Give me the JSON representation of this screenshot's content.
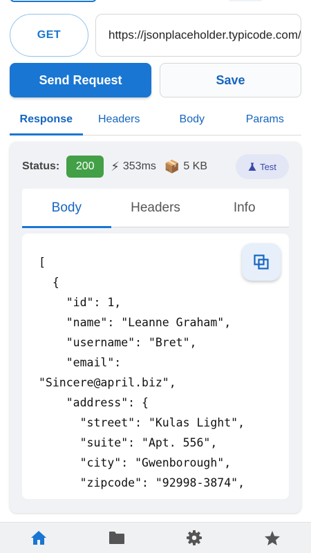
{
  "request": {
    "method": "GET",
    "url": "https://jsonplaceholder.typicode.com/users",
    "send_label": "Send Request",
    "save_label": "Save"
  },
  "main_tabs": [
    {
      "label": "Response",
      "active": true
    },
    {
      "label": "Headers",
      "active": false
    },
    {
      "label": "Body",
      "active": false
    },
    {
      "label": "Params",
      "active": false
    }
  ],
  "response": {
    "status_label": "Status:",
    "status_code": "200",
    "time_icon": "lightning-icon",
    "time": "353ms",
    "size_icon": "package-icon",
    "size": "5 KB",
    "test_icon": "flask-icon",
    "test_label": "Test",
    "sub_tabs": [
      {
        "label": "Body",
        "active": true
      },
      {
        "label": "Headers",
        "active": false
      },
      {
        "label": "Info",
        "active": false
      }
    ],
    "body_text": "[\n  {\n    \"id\": 1,\n    \"name\": \"Leanne Graham\",\n    \"username\": \"Bret\",\n    \"email\":\n\"Sincere@april.biz\",\n    \"address\": {\n      \"street\": \"Kulas Light\",\n      \"suite\": \"Apt. 556\",\n      \"city\": \"Gwenborough\",\n      \"zipcode\": \"92998-3874\",",
    "copy_icon": "copy-icon"
  },
  "bottom_nav": [
    {
      "icon": "home-icon",
      "active": true
    },
    {
      "icon": "folder-icon",
      "active": false
    },
    {
      "icon": "gear-icon",
      "active": false
    },
    {
      "icon": "star-icon",
      "active": false
    }
  ],
  "colors": {
    "primary": "#1976d2",
    "status_ok": "#43a047",
    "nav_inactive": "#555555"
  }
}
